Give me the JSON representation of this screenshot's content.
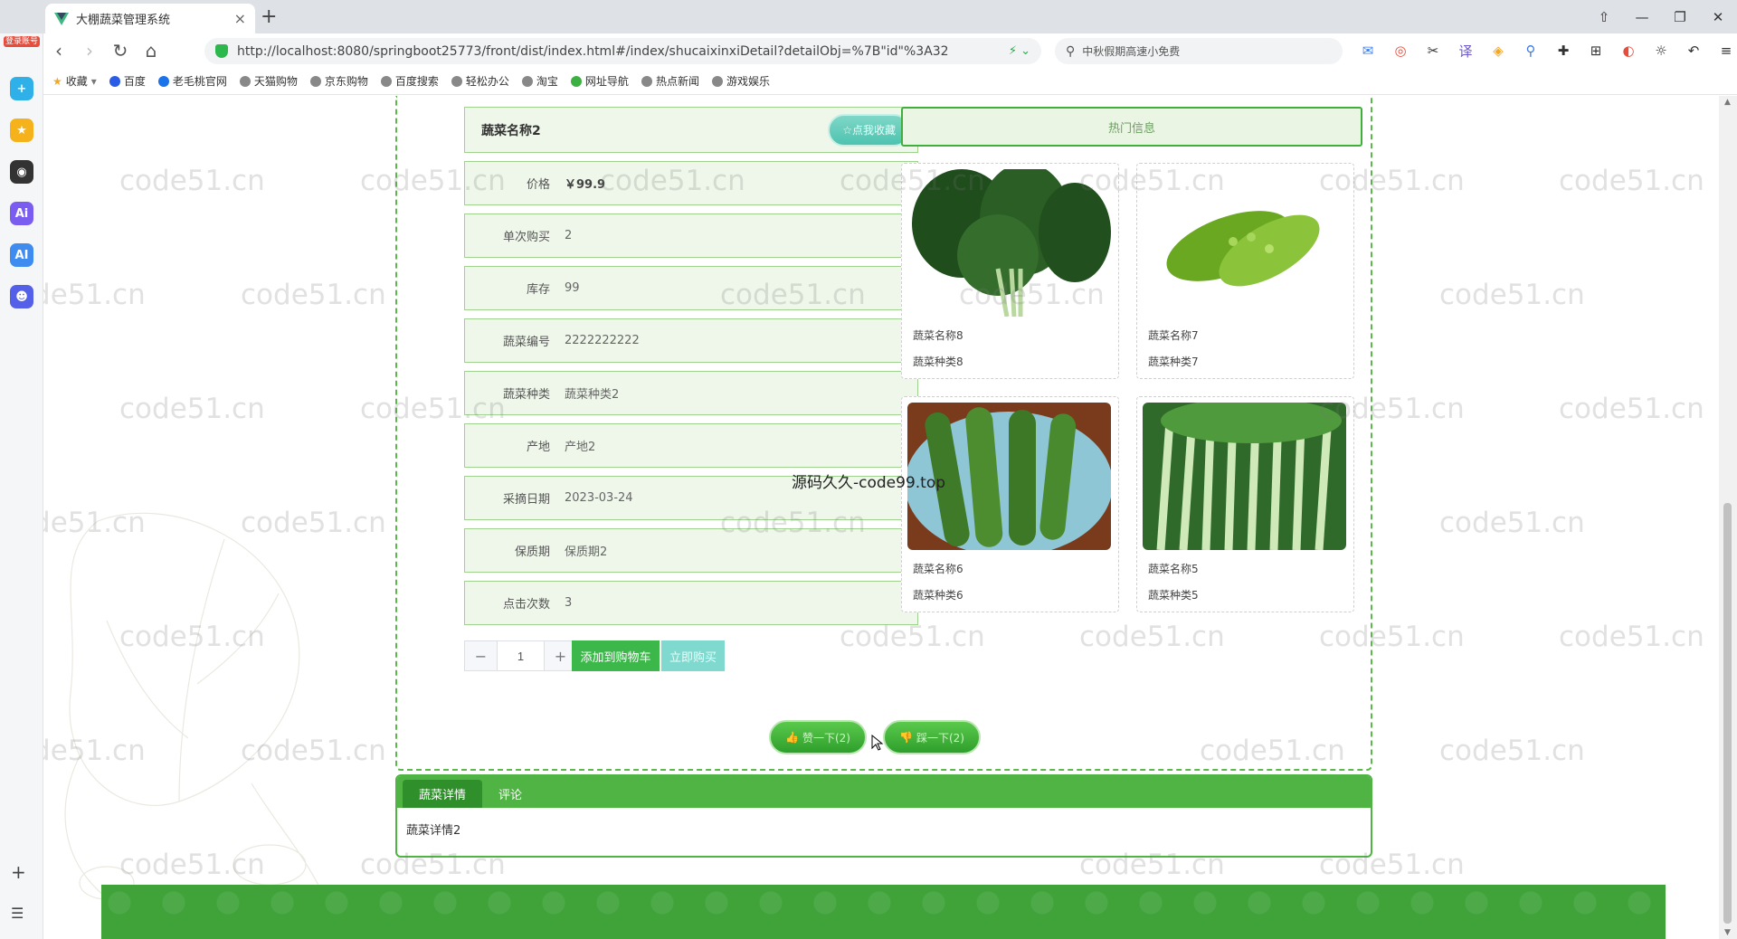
{
  "browser": {
    "tab_title": "大棚蔬菜管理系统",
    "url": "http://localhost:8080/springboot25773/front/dist/index.html#/index/shucaixinxiDetail?detailObj=%7B\"id\"%3A32",
    "search_text": "中秋假期高速小免费",
    "sidebar_badge": "登录账号",
    "bookmarks": [
      "收藏",
      "百度",
      "老毛桃官网",
      "天猫购物",
      "京东购物",
      "百度搜索",
      "轻松办公",
      "淘宝",
      "网址导航",
      "热点新闻",
      "游戏娱乐"
    ]
  },
  "product": {
    "name": "蔬菜名称2",
    "favorite_label": "☆点我收藏",
    "fields": [
      {
        "label": "价格",
        "value": "￥99.9"
      },
      {
        "label": "单次购买",
        "value": "2"
      },
      {
        "label": "库存",
        "value": "99"
      },
      {
        "label": "蔬菜编号",
        "value": "2222222222"
      },
      {
        "label": "蔬菜种类",
        "value": "蔬菜种类2"
      },
      {
        "label": "产地",
        "value": "产地2"
      },
      {
        "label": "采摘日期",
        "value": "2023-03-24"
      },
      {
        "label": "保质期",
        "value": "保质期2"
      },
      {
        "label": "点击次数",
        "value": "3"
      }
    ],
    "quantity": "1",
    "add_cart_label": "添加到购物车",
    "buy_now_label": "立即购买",
    "like_label": "赞一下(2)",
    "dislike_label": "踩一下(2)"
  },
  "hot": {
    "title": "热门信息",
    "items": [
      {
        "name": "蔬菜名称8",
        "type": "蔬菜种类8",
        "image": "spinach"
      },
      {
        "name": "蔬菜名称7",
        "type": "蔬菜种类7",
        "image": "bitter-melon"
      },
      {
        "name": "蔬菜名称6",
        "type": "蔬菜种类6",
        "image": "cucumber"
      },
      {
        "name": "蔬菜名称5",
        "type": "蔬菜种类5",
        "image": "celery"
      }
    ]
  },
  "overlay_text": "源码久久-code99.top",
  "watermark_text": "code51.cn",
  "detail_tabs": {
    "tabs": [
      "蔬菜详情",
      "评论"
    ],
    "content": "蔬菜详情2"
  },
  "colors": {
    "primary_green": "#4fb443",
    "field_bg": "#eef7ea",
    "teal_button": "#7fd9cf"
  }
}
